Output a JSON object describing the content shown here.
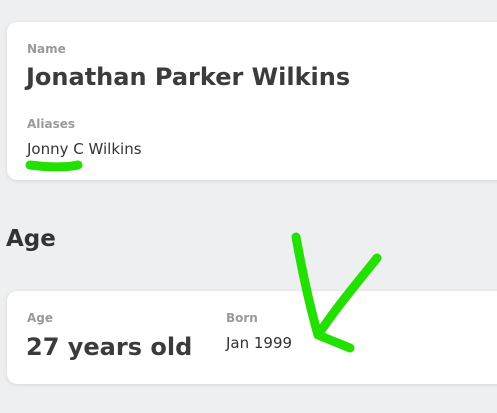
{
  "identity": {
    "name_label": "Name",
    "name_value": "Jonathan Parker Wilkins",
    "aliases_label": "Aliases",
    "aliases_value": "Jonny C Wilkins"
  },
  "age_section": {
    "title": "Age",
    "age_label": "Age",
    "age_value": "27 years old",
    "born_label": "Born",
    "born_value": "Jan 1999"
  },
  "colors": {
    "background": "#eeeff1",
    "card": "#ffffff",
    "label": "#9a9a9a",
    "text": "#333333",
    "annotation": "#22e000"
  }
}
